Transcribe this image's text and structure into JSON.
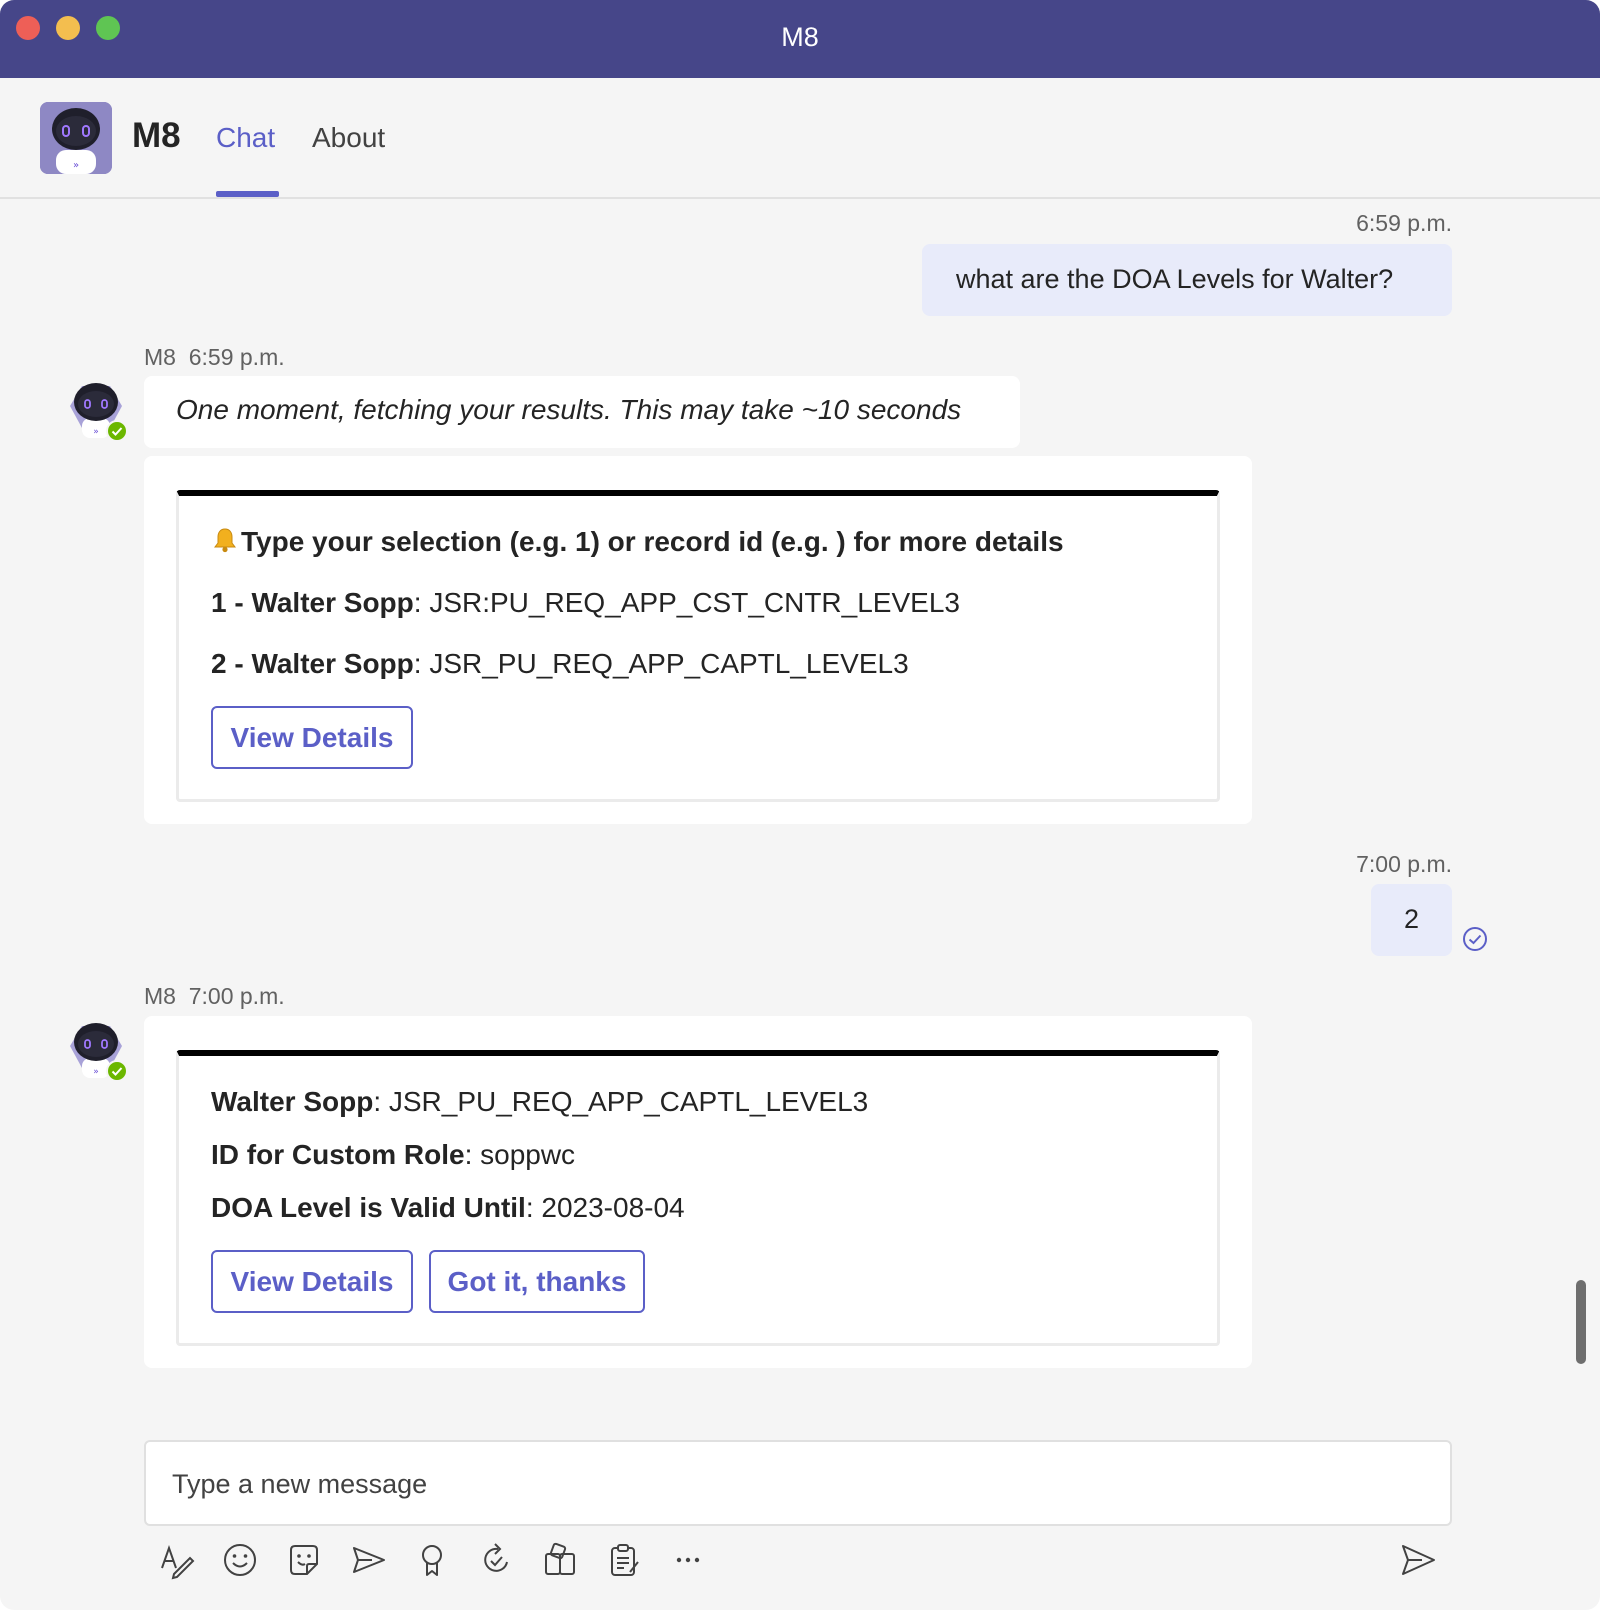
{
  "window": {
    "title": "M8"
  },
  "header": {
    "app_name": "M8",
    "tabs": [
      {
        "label": "Chat",
        "active": true
      },
      {
        "label": "About",
        "active": false
      }
    ]
  },
  "messages": [
    {
      "direction": "outgoing",
      "timestamp": "6:59 p.m.",
      "text": "what are the DOA Levels for Walter?"
    },
    {
      "direction": "incoming",
      "sender": "M8",
      "timestamp": "6:59 p.m.",
      "text": "One moment, fetching your results. This may take ~10 seconds",
      "card": {
        "heading_icon": "bell-icon",
        "heading": "Type your selection (e.g. 1) or record id (e.g. ) for more details",
        "items": [
          {
            "label": "1 - Walter Sopp",
            "value": ": JSR:PU_REQ_APP_CST_CNTR_LEVEL3"
          },
          {
            "label": "2 - Walter Sopp",
            "value": ": JSR_PU_REQ_APP_CAPTL_LEVEL3"
          }
        ],
        "buttons": [
          "View Details"
        ]
      }
    },
    {
      "direction": "outgoing",
      "timestamp": "7:00 p.m.",
      "text": "2",
      "status_icon": "read-receipt-icon"
    },
    {
      "direction": "incoming",
      "sender": "M8",
      "timestamp": "7:00 p.m.",
      "card": {
        "fields": [
          {
            "label": "Walter Sopp",
            "value": ": JSR_PU_REQ_APP_CAPTL_LEVEL3"
          },
          {
            "label": "ID for Custom Role",
            "value": ": soppwc"
          },
          {
            "label": "DOA Level is Valid Until",
            "value": ": 2023-08-04"
          }
        ],
        "buttons": [
          "View Details",
          "Got it, thanks"
        ]
      }
    }
  ],
  "compose": {
    "placeholder": "Type a new message"
  },
  "toolbar": {
    "icons": [
      "format-icon",
      "emoji-icon",
      "sticker-icon",
      "schedule-send-icon",
      "praise-icon",
      "loop-icon",
      "apps-icon",
      "clipboard-icon",
      "more-icon"
    ],
    "send_icon": "send-icon"
  },
  "colors": {
    "brand": "#464689",
    "accent": "#5b5fc7",
    "outgoing_bubble": "#e8ebfa",
    "presence": "#6bb700"
  }
}
